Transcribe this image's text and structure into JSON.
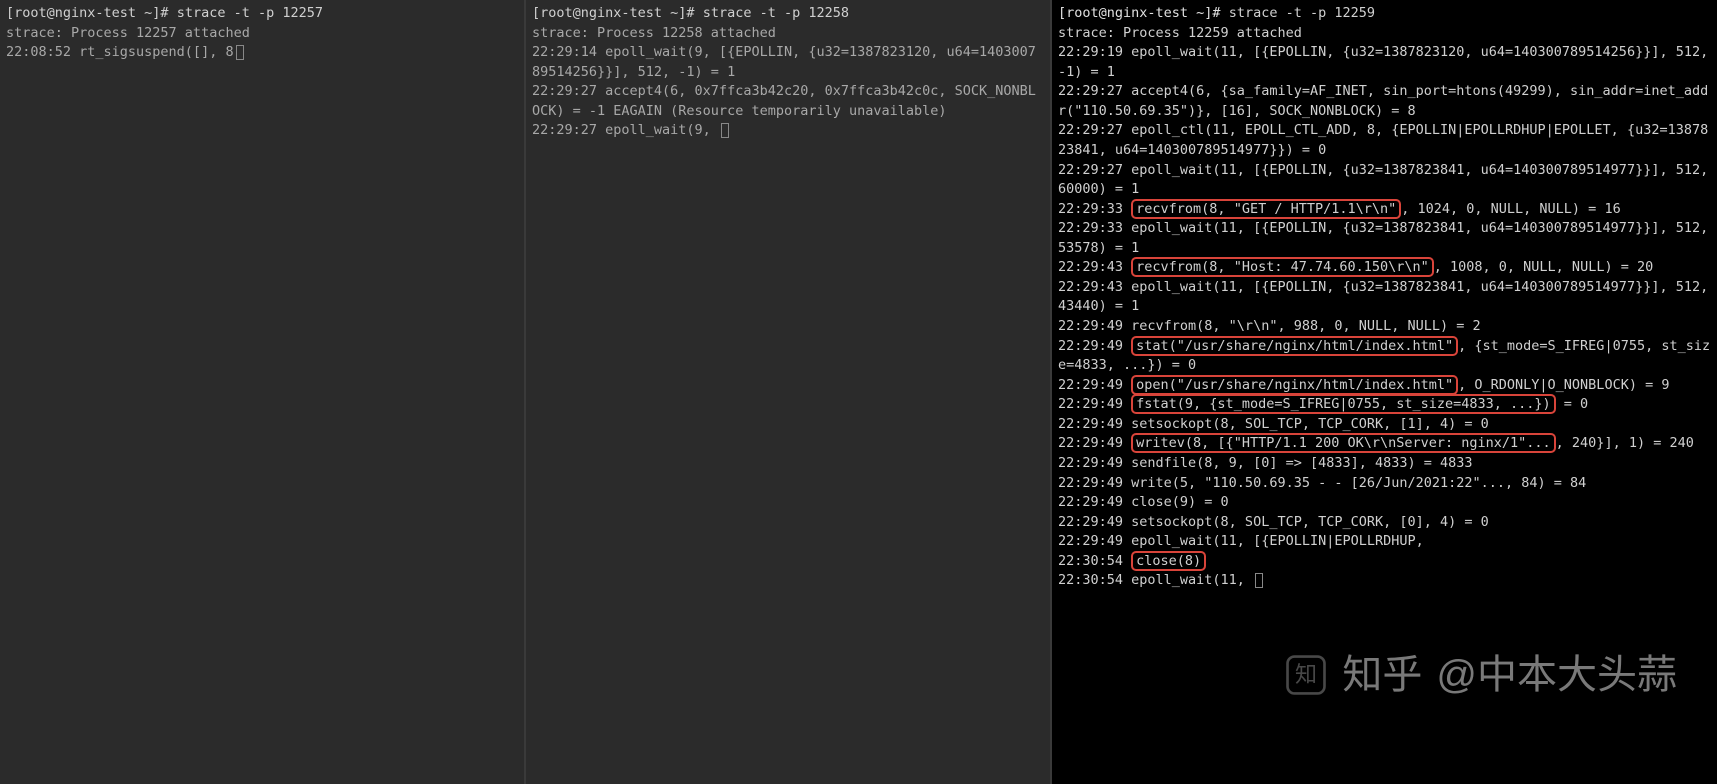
{
  "pane1": {
    "prompt": "[root@nginx-test ~]# ",
    "command": "strace -t -p 12257",
    "attached": "strace: Process 12257 attached",
    "l1a": "22:08:52 rt_sigsuspend([], 8"
  },
  "pane2": {
    "prompt": "[root@nginx-test ~]# ",
    "command": "strace -t -p 12258",
    "attached": "strace: Process 12258 attached",
    "l1": "22:29:14 epoll_wait(9, [{EPOLLIN, {u32=1387823120, u64=140300789514256}}], 512, -1) = 1",
    "l2": "22:29:27 accept4(6, 0x7ffca3b42c20, 0x7ffca3b42c0c, SOCK_NONBLOCK) = -1 EAGAIN (Resource temporarily unavailable)",
    "l3a": "22:29:27 epoll_wait(9, "
  },
  "pane3": {
    "prompt": "[root@nginx-test ~]# ",
    "command": "strace -t -p 12259",
    "attached": "strace: Process 12259 attached",
    "l1": "22:29:19 epoll_wait(11, [{EPOLLIN, {u32=1387823120, u64=140300789514256}}], 512, -1) = 1",
    "l2": "22:29:27 accept4(6, {sa_family=AF_INET, sin_port=htons(49299), sin_addr=inet_addr(\"110.50.69.35\")}, [16], SOCK_NONBLOCK) = 8",
    "l3": "22:29:27 epoll_ctl(11, EPOLL_CTL_ADD, 8, {EPOLLIN|EPOLLRDHUP|EPOLLET, {u32=1387823841, u64=140300789514977}}) = 0",
    "l4": "22:29:27 epoll_wait(11, [{EPOLLIN, {u32=1387823841, u64=140300789514977}}], 512, 60000) = 1",
    "l5a": "22:29:33 ",
    "l5h": "recvfrom(8, \"GET / HTTP/1.1\\r\\n\"",
    "l5b": ", 1024, 0, NULL, NULL) = 16",
    "l6": "22:29:33 epoll_wait(11, [{EPOLLIN, {u32=1387823841, u64=140300789514977}}], 512, 53578) = 1",
    "l7a": "22:29:43 ",
    "l7h": "recvfrom(8, \"Host: 47.74.60.150\\r\\n\"",
    "l7b": ", 1008, 0, NULL, NULL) = 20",
    "l8": "22:29:43 epoll_wait(11, [{EPOLLIN, {u32=1387823841, u64=140300789514977}}], 512, 43440) = 1",
    "l9": "22:29:49 recvfrom(8, \"\\r\\n\", 988, 0, NULL, NULL) = 2",
    "l10a": "22:29:49 ",
    "l10h": "stat(\"/usr/share/nginx/html/index.html\"",
    "l10b": ", {st_mode=S_IFREG|0755, st_size=4833, ...}) = 0",
    "l11a": "22:29:49 ",
    "l11h": "open(\"/usr/share/nginx/html/index.html\"",
    "l11b": ", O_RDONLY|O_NONBLOCK) = 9",
    "l12a": "22:29:49 ",
    "l12h": "fstat(9, {st_mode=S_IFREG|0755, st_size=4833, ...})",
    "l12b": " = 0",
    "l13": "22:29:49 setsockopt(8, SOL_TCP, TCP_CORK, [1], 4) = 0",
    "l14a": "22:29:49 ",
    "l14h": "writev(8, [{\"HTTP/1.1 200 OK\\r\\nServer: nginx/1\"...",
    "l14b": ", 240}], 1) = 240",
    "l15": "22:29:49 sendfile(8, 9, [0] => [4833], 4833) = 4833",
    "l16": "22:29:49 write(5, \"110.50.69.35 - - [26/Jun/2021:22\"..., 84) = 84",
    "l17": "22:29:49 close(9)                       = 0",
    "l18": "22:29:49 setsockopt(8, SOL_TCP, TCP_CORK, [0], 4) = 0",
    "l19": "22:29:49 epoll_wait(11, [{EPOLLIN|EPOLLRDHUP,",
    "l20a": "22:30:54 ",
    "l20h": "close(8)",
    "l21a": "22:30:54 epoll_wait(11, "
  },
  "watermark": {
    "brand": "知乎",
    "author": "@中本大头蒜"
  }
}
